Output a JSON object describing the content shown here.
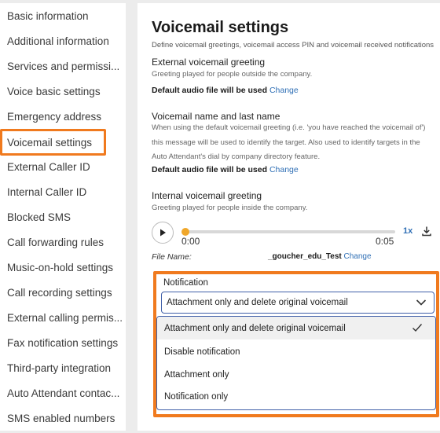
{
  "sidebar": {
    "items": [
      {
        "label": "Basic information"
      },
      {
        "label": "Additional information"
      },
      {
        "label": "Services and permissi..."
      },
      {
        "label": "Voice basic settings"
      },
      {
        "label": "Emergency address"
      },
      {
        "label": "Voicemail settings",
        "active": true
      },
      {
        "label": "External Caller ID"
      },
      {
        "label": "Internal Caller ID"
      },
      {
        "label": "Blocked SMS"
      },
      {
        "label": "Call forwarding rules"
      },
      {
        "label": "Music-on-hold settings"
      },
      {
        "label": "Call recording settings"
      },
      {
        "label": "External calling permis..."
      },
      {
        "label": "Fax notification settings"
      },
      {
        "label": "Third-party integration"
      },
      {
        "label": "Auto Attendant contac..."
      },
      {
        "label": "SMS enabled numbers"
      }
    ]
  },
  "main": {
    "title": "Voicemail settings",
    "subtitle": "Define voicemail greetings, voicemail access PIN and voicemail received notifications",
    "external_greeting": {
      "title": "External voicemail greeting",
      "description": "Greeting played for people outside the company.",
      "status": "Default audio file will be used",
      "change": "Change"
    },
    "name_greeting": {
      "title": "Voicemail name and last name",
      "description": "When using the default voicemail greeting (i.e. 'you have reached the voicemail of') this message will be used to identify the target. Also used to identify targets in the Auto Attendant's dial by company directory feature.",
      "status": "Default audio file will be used",
      "change": "Change"
    },
    "internal_greeting": {
      "title": "Internal voicemail greeting",
      "description": "Greeting played for people inside the company.",
      "player": {
        "time_current": "0:00",
        "time_total": "0:05",
        "speed": "1x",
        "progress": 0
      },
      "file_label": "File Name:",
      "file_name": "_goucher_edu_Test",
      "change": "Change"
    },
    "notification": {
      "label": "Notification",
      "selected": "Attachment only and delete original voicemail",
      "options": [
        "Attachment only and delete original voicemail",
        "Disable notification",
        "Attachment only",
        "Notification only"
      ]
    }
  },
  "colors": {
    "highlight": "#f07a1e",
    "link": "#2f6fb5",
    "slider_thumb": "#f0a72a",
    "select_border": "#3f5fa8"
  }
}
